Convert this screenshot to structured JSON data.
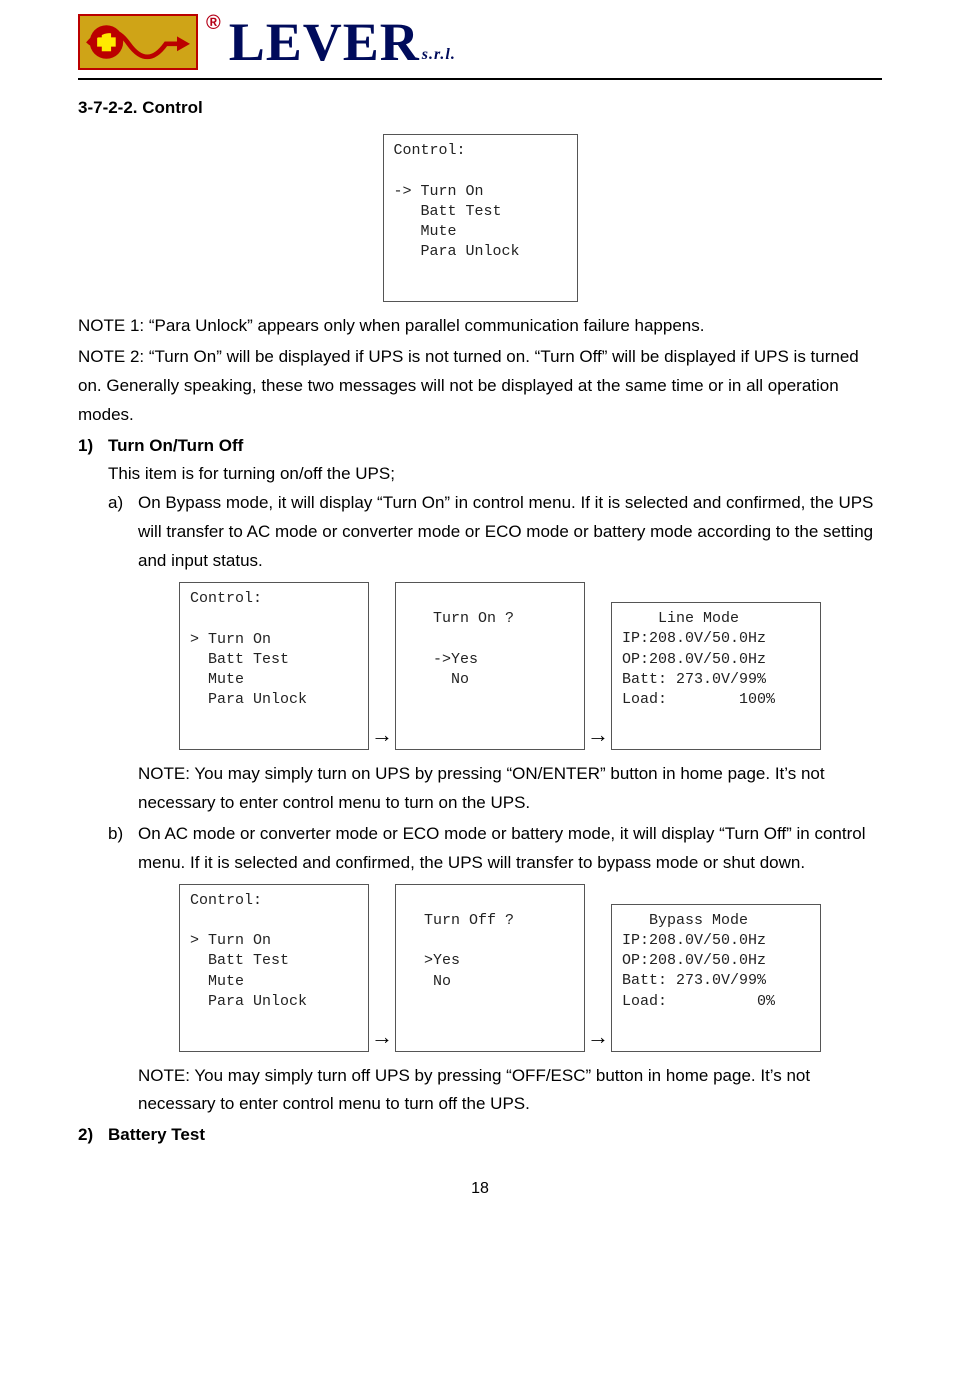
{
  "logo": {
    "brand": "LEVER",
    "suffix": "s.r.l.",
    "regmark": "®"
  },
  "section_heading": "3-7-2-2. Control",
  "screen_top": {
    "title": "Control:",
    "cursor": "->",
    "items": [
      "Turn On",
      "Batt Test",
      "Mute",
      "Para Unlock"
    ]
  },
  "note1": "NOTE 1: “Para Unlock” appears only when parallel communication failure happens.",
  "note2": "NOTE 2: “Turn On” will be displayed if UPS is not turned on. “Turn Off” will be displayed if UPS is turned on. Generally speaking, these two messages will not be displayed at the same time or in all operation modes.",
  "item1": {
    "marker": "1)",
    "title": "Turn On/Turn Off",
    "desc": "This item is for turning on/off the UPS;",
    "a_marker": "a)",
    "a_text": "On Bypass mode, it will display “Turn On” in control menu. If it is selected and confirmed, the UPS will transfer to AC mode or converter mode or ECO mode or battery mode according to the setting and input status.",
    "a_note": "NOTE: You may simply turn on UPS by pressing “ON/ENTER” button in home page. It’s not necessary to enter control menu to turn on the UPS.",
    "a_screens": {
      "s1": {
        "title": "Control:",
        "cursor": ">",
        "items": [
          "Turn On",
          "Batt Test",
          "Mute",
          "Para Unlock"
        ]
      },
      "s2": {
        "prompt": "Turn On ?",
        "cursor": "->",
        "opts": [
          "Yes",
          "No"
        ]
      },
      "s3": {
        "mode": "Line Mode",
        "ip": "IP:208.0V/50.0Hz",
        "op": "OP:208.0V/50.0Hz",
        "batt": "Batt: 273.0V/99%",
        "load": "Load:        100%"
      }
    },
    "b_marker": "b)",
    "b_text": "On AC mode or converter mode or ECO mode or battery mode, it will display “Turn Off” in control menu. If it is selected and confirmed, the UPS will transfer to bypass mode or shut down.",
    "b_note": "NOTE: You may simply turn off UPS by pressing “OFF/ESC” button in home page. It’s not necessary to enter control menu to turn off the UPS.",
    "b_screens": {
      "s1": {
        "title": "Control:",
        "cursor": ">",
        "items": [
          "Turn On",
          "Batt Test",
          "Mute",
          "Para Unlock"
        ]
      },
      "s2": {
        "prompt": "Turn Off ?",
        "cursor": ">",
        "opts": [
          "Yes",
          "No"
        ]
      },
      "s3": {
        "mode": "Bypass Mode",
        "ip": "IP:208.0V/50.0Hz",
        "op": "OP:208.0V/50.0Hz",
        "batt": "Batt: 273.0V/99%",
        "load": "Load:          0%"
      }
    }
  },
  "item2": {
    "marker": "2)",
    "title": "Battery Test"
  },
  "arrow": "→",
  "page_number": "18"
}
